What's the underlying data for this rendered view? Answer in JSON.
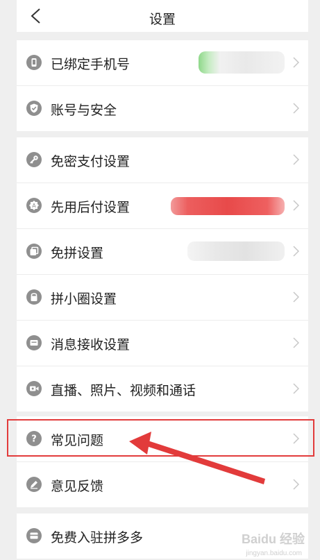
{
  "header": {
    "title": "设置"
  },
  "sections": [
    {
      "items": [
        {
          "label": "已绑定手机号",
          "icon": "phone-icon"
        },
        {
          "label": "账号与安全",
          "icon": "shield-icon"
        }
      ]
    },
    {
      "items": [
        {
          "label": "免密支付设置",
          "icon": "key-icon"
        },
        {
          "label": "先用后付设置",
          "icon": "badge-icon"
        },
        {
          "label": "免拼设置",
          "icon": "copy-icon"
        },
        {
          "label": "拼小圈设置",
          "icon": "lock-icon"
        },
        {
          "label": "消息接收设置",
          "icon": "message-icon"
        },
        {
          "label": "直播、照片、视频和通话",
          "icon": "video-icon"
        }
      ]
    },
    {
      "items": [
        {
          "label": "常见问题",
          "icon": "question-icon"
        },
        {
          "label": "意见反馈",
          "icon": "pencil-icon"
        }
      ]
    },
    {
      "items": [
        {
          "label": "免费入驻拼多多",
          "icon": "store-icon"
        }
      ]
    }
  ],
  "colors": {
    "icon": "#8f8f8f",
    "highlight": "#e23b3b",
    "background": "#efefef"
  },
  "watermark": {
    "text": "Baidu 经验",
    "sub": "jingyan.baidu.com"
  }
}
